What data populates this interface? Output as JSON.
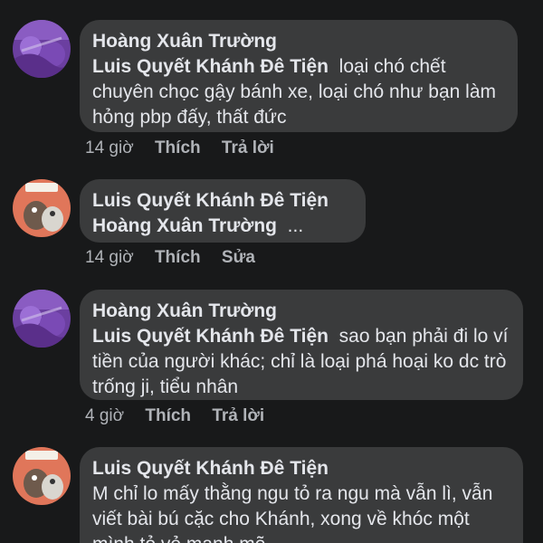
{
  "comments": [
    {
      "author": "Hoàng Xuân Trường",
      "mention": "Luis Quyết Khánh Đê Tiện",
      "text": "loại chó chết chuyên chọc gậy bánh xe, loại chó như bạn làm hỏng pbp đấy, thất đức",
      "time": "14 giờ",
      "like_label": "Thích",
      "action_label": "Trả lời"
    },
    {
      "author": "Luis Quyết Khánh Đê Tiện",
      "mention": "Hoàng Xuân Trường",
      "text": "...",
      "time": "14 giờ",
      "like_label": "Thích",
      "action_label": "Sửa"
    },
    {
      "author": "Hoàng Xuân Trường",
      "mention": "Luis Quyết Khánh Đê Tiện",
      "text": "sao bạn phải đi lo ví tiền của người khác; chỉ là loại phá hoại ko dc trò trống ji, tiểu nhân",
      "time": "4 giờ",
      "like_label": "Thích",
      "action_label": "Trả lời"
    },
    {
      "author": "Luis Quyết Khánh Đê Tiện",
      "mention": "",
      "text": "M  chỉ lo mấy thằng ngu tỏ ra ngu mà vẫn lì, vẫn viết bài bú cặc cho Khánh, xong về khóc một mình tỏ vẻ mạnh mẽ",
      "time": "",
      "like_label": "",
      "action_label": ""
    }
  ],
  "colors": {
    "background": "#18191a",
    "bubble": "#3a3b3c",
    "text": "#e4e6eb",
    "meta": "#b0b3b8"
  }
}
